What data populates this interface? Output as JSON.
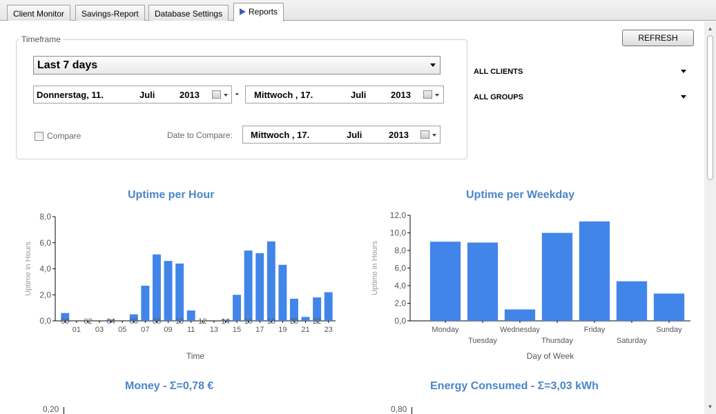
{
  "tabs": [
    {
      "label": "Client Monitor",
      "active": false
    },
    {
      "label": "Savings-Report",
      "active": false
    },
    {
      "label": "Database Settings",
      "active": false
    },
    {
      "label": "Reports",
      "active": true
    }
  ],
  "toolbar": {
    "refresh_label": "REFRESH"
  },
  "timeframe": {
    "legend": "Timeframe",
    "preset": "Last 7 days",
    "from": {
      "weekday": "Donnerstag, 11.",
      "month": "Juli",
      "year": "2013"
    },
    "separator": "-",
    "to": {
      "weekday": "Mittwoch  , 17.",
      "month": "Juli",
      "year": "2013"
    },
    "compare_label": "Compare",
    "compare_checked": false,
    "date_to_compare_label": "Date to Compare:",
    "compare_date": {
      "weekday": "Mittwoch  , 17.",
      "month": "Juli",
      "year": "2013"
    }
  },
  "filters": {
    "clients": "ALL CLIENTS",
    "groups": "ALL GROUPS"
  },
  "colors": {
    "bar": "#4285e8",
    "title": "#4a86c8",
    "axis_text": "#555555"
  },
  "chart_data": [
    {
      "type": "bar",
      "title": "Uptime per Hour",
      "xlabel": "Time",
      "ylabel": "Uptime in Hours",
      "ylim": [
        0,
        8
      ],
      "yticks": [
        "0,0",
        "2,0",
        "4,0",
        "6,0",
        "8,0"
      ],
      "categories": [
        "00",
        "01",
        "02",
        "03",
        "04",
        "05",
        "06",
        "07",
        "08",
        "09",
        "10",
        "11",
        "12",
        "13",
        "14",
        "15",
        "16",
        "17",
        "18",
        "19",
        "20",
        "21",
        "22",
        "23"
      ],
      "values": [
        0.6,
        0,
        0,
        0,
        0.1,
        0,
        0.5,
        2.7,
        5.1,
        4.6,
        4.4,
        0.8,
        0,
        0,
        0.1,
        2.0,
        5.4,
        5.2,
        6.1,
        4.3,
        1.7,
        0.3,
        1.8,
        2.2
      ]
    },
    {
      "type": "bar",
      "title": "Uptime per Weekday",
      "xlabel": "Day of Week",
      "ylabel": "Uptime in Hours",
      "ylim": [
        0,
        12
      ],
      "yticks": [
        "0,0",
        "2,0",
        "4,0",
        "6,0",
        "8,0",
        "10,0",
        "12,0"
      ],
      "categories": [
        "Monday",
        "Tuesday",
        "Wednesday",
        "Thursday",
        "Friday",
        "Saturday",
        "Sunday"
      ],
      "values": [
        9.0,
        8.9,
        1.3,
        10.0,
        11.3,
        4.5,
        3.1
      ]
    },
    {
      "type": "bar",
      "title": "Money - Σ=0,78 €",
      "ylim_label": "0,20"
    },
    {
      "type": "bar",
      "title": "Energy Consumed - Σ=3,03 kWh",
      "ylim_label": "0,80"
    }
  ]
}
